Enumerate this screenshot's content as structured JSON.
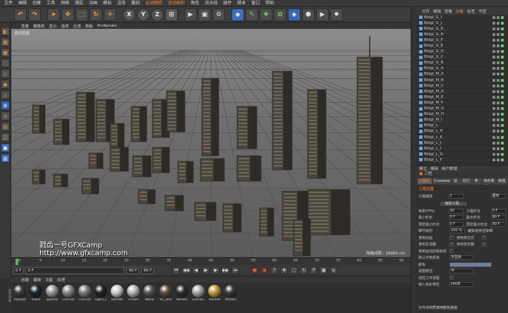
{
  "menubar": [
    "文件",
    "编辑",
    "创建",
    "工具",
    "网格",
    "捕捉",
    "动画",
    "模拟",
    "渲染",
    "雕刻",
    "运动跟踪",
    "运动图形",
    "角色",
    "流水线",
    "插件",
    "脚本",
    "窗口",
    "帮助"
  ],
  "menubar_highlight": [
    "运动跟踪",
    "运动图形"
  ],
  "toolbar": {
    "axis_x": "X",
    "axis_y": "Y",
    "axis_z": "Z"
  },
  "viewport": {
    "menu": [
      "查看",
      "摄像机",
      "显示",
      "选项",
      "过滤",
      "面板",
      "ProRender"
    ],
    "label": "透视视图",
    "grid_info": "网格间距 : 10000 cm"
  },
  "watermark": {
    "line1": "戮齿一号GFXCamp",
    "line2": "http://www.gfxcamp.com"
  },
  "timeline": {
    "ticks": [
      "0",
      "5",
      "10",
      "15",
      "20",
      "25",
      "30",
      "35",
      "40",
      "45",
      "50",
      "55",
      "60",
      "65",
      "70",
      "75",
      "80",
      "85",
      "90"
    ],
    "end_label": "0 F"
  },
  "transport": {
    "start": "0 F",
    "current": "0 F",
    "end": "90 F",
    "max": "90 F"
  },
  "material_manager": {
    "menu": [
      "创建",
      "编辑",
      "功能",
      "纹理"
    ],
    "materials": [
      {
        "name": "Asphalt",
        "color": "#3a3a3a"
      },
      {
        "name": "Glass",
        "color": "#1c2630"
      },
      {
        "name": "Speedo",
        "color": "#9a9a9a"
      },
      {
        "name": "Concret",
        "color": "#8a8a8a"
      },
      {
        "name": "Concret",
        "color": "#7c7c7c"
      },
      {
        "name": "Signs_L",
        "color": "#202020"
      },
      {
        "name": "SafeWe",
        "color": "#d0d0d0"
      },
      {
        "name": "Chrom",
        "color": "#b8b8b8"
      },
      {
        "name": "Metal",
        "color": "#555555"
      },
      {
        "name": "Pic_Ban",
        "color": "#5b4a3a"
      },
      {
        "name": "MetalG",
        "color": "#2c2c2c"
      },
      {
        "name": "Galvani",
        "color": "#a8a8a8"
      },
      {
        "name": "Painted",
        "color": "#c29a3c"
      },
      {
        "name": "MetalG",
        "color": "#3a3a3a"
      }
    ]
  },
  "objects_panel": {
    "menu": [
      "文件",
      "编辑",
      "查看",
      "对象",
      "标签",
      "书签"
    ],
    "highlight": "对象",
    "items": [
      "Bldgl_G_I",
      "Bldgl_G_J",
      "Bldgl_G_K",
      "Bldgl_G_H",
      "Bldgl_G_F",
      "Bldgl_G_E",
      "Bldgl_G_D",
      "Bldgl_G_C",
      "Bldgl_G_B",
      "Bldgl_G_A",
      "Bldgl_M_A",
      "Bldgl_M_B",
      "Bldgl_M_C",
      "Bldgl_M_D",
      "Bldgl_M_E",
      "Bldgl_M_F",
      "Bldgl_M_G",
      "Bldgl_M_H",
      "Bldgl_M_I",
      "Bldgl_L",
      "Bldgl_L_H",
      "Bldgl_L_K",
      "Bldgl_L_J",
      "Bldgl_L_I",
      "Bldgl_L_G",
      "Bldgl_L_F"
    ]
  },
  "attributes_panel": {
    "tabs": [
      "模式",
      "编辑",
      "用户数据"
    ],
    "title": "工程",
    "subtabs": [
      "工程设置",
      "Cineware",
      "信息",
      "动力学",
      "参考",
      "待办事项",
      "帧插值"
    ],
    "active_subtab": "工程设置",
    "heading": "工程设置",
    "rows": [
      {
        "label": "工程缩放",
        "value": "1",
        "label2": "",
        "value2": "厘米"
      }
    ],
    "scale_button": "缩放工程...",
    "rows2": [
      {
        "label": "帧率(FPS)",
        "value": "30",
        "label2": "工程时长",
        "value2": "0 F"
      },
      {
        "label": "最小时长",
        "value": "0 F",
        "label2": "最大时长",
        "value2": "90 F"
      },
      {
        "label": "预览最小时长",
        "value": "0 F",
        "label2": "预览最大时长",
        "value2": "90 F"
      },
      {
        "label": "细节级别",
        "value": "100 %",
        "label2": "编辑使用渲染细节",
        "value2": ""
      }
    ],
    "checks": [
      {
        "label": "使用动画",
        "label2": "使用表达式"
      },
      {
        "label": "使用生成器",
        "label2": "使用变形器"
      },
      {
        "label": "使用运动剪辑系统",
        "label2": ""
      }
    ],
    "default_color_label": "默认对象颜色",
    "default_color_value": "灰蓝色",
    "color_label": "颜色",
    "view_clip_label": "视图修剪",
    "view_clip_value": "中",
    "linear_label": "线性工作流程",
    "input_color_label": "输入色彩特性",
    "input_color_value": "sRGB",
    "footer": "为节点材质使用颜色通道"
  }
}
